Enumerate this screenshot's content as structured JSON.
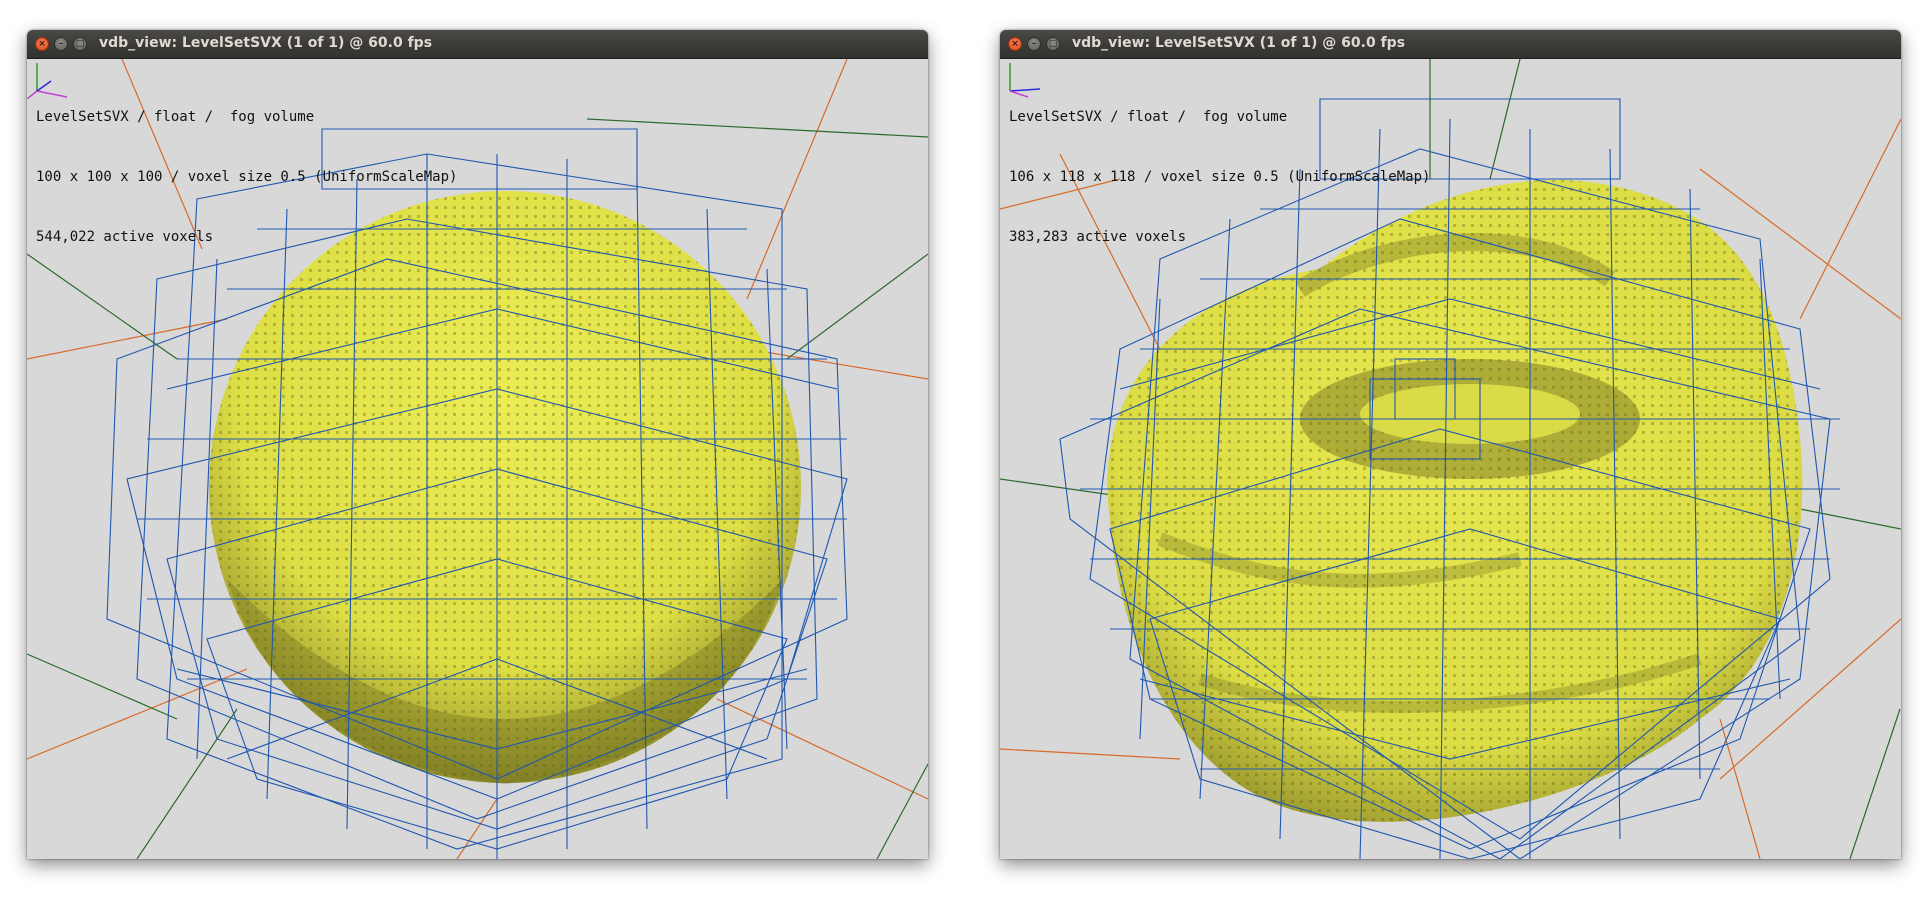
{
  "colors": {
    "background": "#d8d8d8",
    "voxel": "#e2e24a",
    "voxel_shade": "#6f6d22",
    "grid": "#1f57b0",
    "axis_orange": "#d86a2a",
    "axis_green": "#2c6a2c"
  },
  "windows": [
    {
      "title": "vdb_view: LevelSetSVX (1 of 1) @ 60.0 fps",
      "info": [
        "LevelSetSVX / float /  fog volume",
        "100 x 100 x 100 / voxel size 0.5 (UniformScaleMap)",
        "544,022 active voxels"
      ]
    },
    {
      "title": "vdb_view: LevelSetSVX (1 of 1) @ 60.0 fps",
      "info": [
        "LevelSetSVX / float /  fog volume",
        "106 x 118 x 118 / voxel size 0.5 (UniformScaleMap)",
        "383,283 active voxels"
      ]
    }
  ],
  "icons": {
    "close": "close-icon",
    "minimize": "minimize-icon",
    "maximize": "maximize-icon",
    "axis_gizmo": "axis-gizmo-icon"
  }
}
